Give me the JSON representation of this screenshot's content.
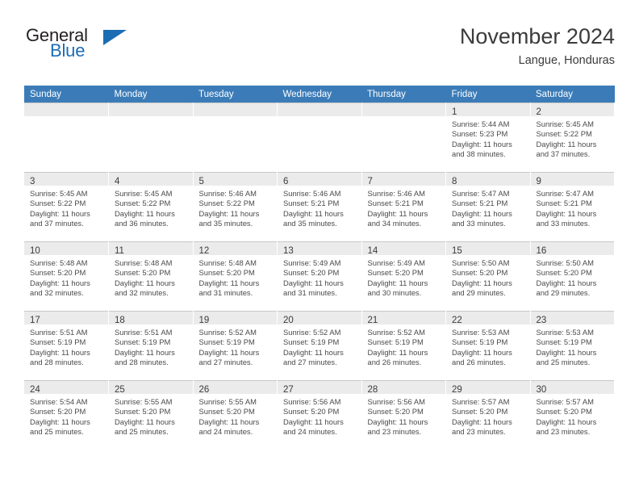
{
  "brand": {
    "name_top": "General",
    "name_bottom": "Blue",
    "logo_icon": "triangle-icon",
    "accent_color": "#1c6cb4"
  },
  "header": {
    "title": "November 2024",
    "subtitle": "Langue, Honduras"
  },
  "theme": {
    "header_row_bg": "#3b7cb8",
    "daynum_bar_bg": "#ebebeb",
    "grid_line": "#c8c8c8",
    "text": "#3b3b3b"
  },
  "calendar": {
    "columns": [
      "Sunday",
      "Monday",
      "Tuesday",
      "Wednesday",
      "Thursday",
      "Friday",
      "Saturday"
    ],
    "weeks": [
      [
        {
          "day": "",
          "lines": []
        },
        {
          "day": "",
          "lines": []
        },
        {
          "day": "",
          "lines": []
        },
        {
          "day": "",
          "lines": []
        },
        {
          "day": "",
          "lines": []
        },
        {
          "day": "1",
          "lines": [
            "Sunrise: 5:44 AM",
            "Sunset: 5:23 PM",
            "Daylight: 11 hours",
            "and 38 minutes."
          ]
        },
        {
          "day": "2",
          "lines": [
            "Sunrise: 5:45 AM",
            "Sunset: 5:22 PM",
            "Daylight: 11 hours",
            "and 37 minutes."
          ]
        }
      ],
      [
        {
          "day": "3",
          "lines": [
            "Sunrise: 5:45 AM",
            "Sunset: 5:22 PM",
            "Daylight: 11 hours",
            "and 37 minutes."
          ]
        },
        {
          "day": "4",
          "lines": [
            "Sunrise: 5:45 AM",
            "Sunset: 5:22 PM",
            "Daylight: 11 hours",
            "and 36 minutes."
          ]
        },
        {
          "day": "5",
          "lines": [
            "Sunrise: 5:46 AM",
            "Sunset: 5:22 PM",
            "Daylight: 11 hours",
            "and 35 minutes."
          ]
        },
        {
          "day": "6",
          "lines": [
            "Sunrise: 5:46 AM",
            "Sunset: 5:21 PM",
            "Daylight: 11 hours",
            "and 35 minutes."
          ]
        },
        {
          "day": "7",
          "lines": [
            "Sunrise: 5:46 AM",
            "Sunset: 5:21 PM",
            "Daylight: 11 hours",
            "and 34 minutes."
          ]
        },
        {
          "day": "8",
          "lines": [
            "Sunrise: 5:47 AM",
            "Sunset: 5:21 PM",
            "Daylight: 11 hours",
            "and 33 minutes."
          ]
        },
        {
          "day": "9",
          "lines": [
            "Sunrise: 5:47 AM",
            "Sunset: 5:21 PM",
            "Daylight: 11 hours",
            "and 33 minutes."
          ]
        }
      ],
      [
        {
          "day": "10",
          "lines": [
            "Sunrise: 5:48 AM",
            "Sunset: 5:20 PM",
            "Daylight: 11 hours",
            "and 32 minutes."
          ]
        },
        {
          "day": "11",
          "lines": [
            "Sunrise: 5:48 AM",
            "Sunset: 5:20 PM",
            "Daylight: 11 hours",
            "and 32 minutes."
          ]
        },
        {
          "day": "12",
          "lines": [
            "Sunrise: 5:48 AM",
            "Sunset: 5:20 PM",
            "Daylight: 11 hours",
            "and 31 minutes."
          ]
        },
        {
          "day": "13",
          "lines": [
            "Sunrise: 5:49 AM",
            "Sunset: 5:20 PM",
            "Daylight: 11 hours",
            "and 31 minutes."
          ]
        },
        {
          "day": "14",
          "lines": [
            "Sunrise: 5:49 AM",
            "Sunset: 5:20 PM",
            "Daylight: 11 hours",
            "and 30 minutes."
          ]
        },
        {
          "day": "15",
          "lines": [
            "Sunrise: 5:50 AM",
            "Sunset: 5:20 PM",
            "Daylight: 11 hours",
            "and 29 minutes."
          ]
        },
        {
          "day": "16",
          "lines": [
            "Sunrise: 5:50 AM",
            "Sunset: 5:20 PM",
            "Daylight: 11 hours",
            "and 29 minutes."
          ]
        }
      ],
      [
        {
          "day": "17",
          "lines": [
            "Sunrise: 5:51 AM",
            "Sunset: 5:19 PM",
            "Daylight: 11 hours",
            "and 28 minutes."
          ]
        },
        {
          "day": "18",
          "lines": [
            "Sunrise: 5:51 AM",
            "Sunset: 5:19 PM",
            "Daylight: 11 hours",
            "and 28 minutes."
          ]
        },
        {
          "day": "19",
          "lines": [
            "Sunrise: 5:52 AM",
            "Sunset: 5:19 PM",
            "Daylight: 11 hours",
            "and 27 minutes."
          ]
        },
        {
          "day": "20",
          "lines": [
            "Sunrise: 5:52 AM",
            "Sunset: 5:19 PM",
            "Daylight: 11 hours",
            "and 27 minutes."
          ]
        },
        {
          "day": "21",
          "lines": [
            "Sunrise: 5:52 AM",
            "Sunset: 5:19 PM",
            "Daylight: 11 hours",
            "and 26 minutes."
          ]
        },
        {
          "day": "22",
          "lines": [
            "Sunrise: 5:53 AM",
            "Sunset: 5:19 PM",
            "Daylight: 11 hours",
            "and 26 minutes."
          ]
        },
        {
          "day": "23",
          "lines": [
            "Sunrise: 5:53 AM",
            "Sunset: 5:19 PM",
            "Daylight: 11 hours",
            "and 25 minutes."
          ]
        }
      ],
      [
        {
          "day": "24",
          "lines": [
            "Sunrise: 5:54 AM",
            "Sunset: 5:20 PM",
            "Daylight: 11 hours",
            "and 25 minutes."
          ]
        },
        {
          "day": "25",
          "lines": [
            "Sunrise: 5:55 AM",
            "Sunset: 5:20 PM",
            "Daylight: 11 hours",
            "and 25 minutes."
          ]
        },
        {
          "day": "26",
          "lines": [
            "Sunrise: 5:55 AM",
            "Sunset: 5:20 PM",
            "Daylight: 11 hours",
            "and 24 minutes."
          ]
        },
        {
          "day": "27",
          "lines": [
            "Sunrise: 5:56 AM",
            "Sunset: 5:20 PM",
            "Daylight: 11 hours",
            "and 24 minutes."
          ]
        },
        {
          "day": "28",
          "lines": [
            "Sunrise: 5:56 AM",
            "Sunset: 5:20 PM",
            "Daylight: 11 hours",
            "and 23 minutes."
          ]
        },
        {
          "day": "29",
          "lines": [
            "Sunrise: 5:57 AM",
            "Sunset: 5:20 PM",
            "Daylight: 11 hours",
            "and 23 minutes."
          ]
        },
        {
          "day": "30",
          "lines": [
            "Sunrise: 5:57 AM",
            "Sunset: 5:20 PM",
            "Daylight: 11 hours",
            "and 23 minutes."
          ]
        }
      ]
    ]
  }
}
